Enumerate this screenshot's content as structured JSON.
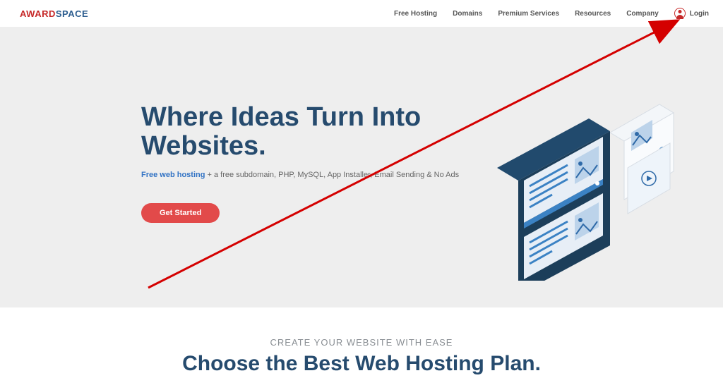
{
  "logo": {
    "part1": "AWARD",
    "part2": "SPACE"
  },
  "nav": {
    "items": [
      "Free Hosting",
      "Domains",
      "Premium Services",
      "Resources",
      "Company"
    ],
    "login": "Login"
  },
  "hero": {
    "headline": "Where Ideas Turn Into Websites.",
    "sub_link": "Free web hosting",
    "sub_rest": " + a free subdomain, PHP, MySQL, App Installer, Email Sending & No Ads",
    "cta": "Get Started"
  },
  "bottom": {
    "eyebrow": "CREATE YOUR WEBSITE WITH EASE",
    "headline": "Choose the Best Web Hosting Plan."
  },
  "colors": {
    "brand_red": "#c62828",
    "brand_blue": "#264b6e",
    "cta_red": "#e24a4a",
    "link_blue": "#3273c4",
    "hero_bg": "#eeeeee"
  }
}
